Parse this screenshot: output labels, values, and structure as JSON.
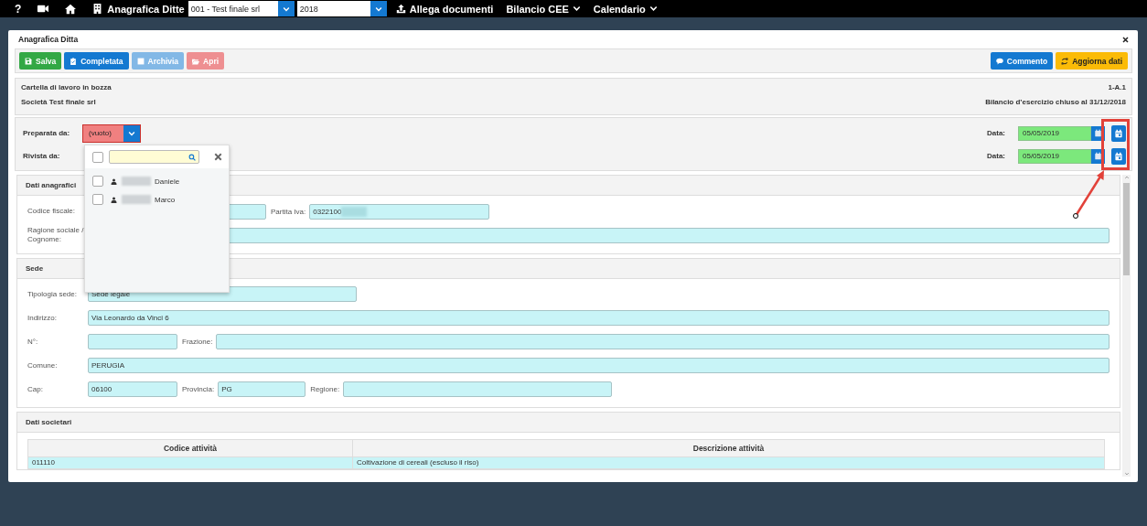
{
  "topbar": {
    "help": "?",
    "title": "Anagrafica Ditte",
    "company": "001 - Test finale srl",
    "year": "2018",
    "menu": [
      {
        "label": "Allega documenti",
        "kind": "upload"
      },
      {
        "label": "Bilancio CEE",
        "kind": "dropdown"
      },
      {
        "label": "Calendario",
        "kind": "dropdown"
      }
    ]
  },
  "window": {
    "title": "Anagrafica Ditta"
  },
  "toolbar": {
    "buttons": [
      {
        "label": "Salva",
        "kind": "save",
        "disabled": false
      },
      {
        "label": "Completata",
        "kind": "complete",
        "disabled": false
      },
      {
        "label": "Archivia",
        "kind": "archive",
        "disabled": true
      },
      {
        "label": "Apri",
        "kind": "open",
        "disabled": true
      }
    ],
    "actions": [
      {
        "label": "Commento",
        "kind": "comment"
      },
      {
        "label": "Aggiorna dati",
        "kind": "refresh"
      }
    ]
  },
  "info": {
    "status": "Cartella di lavoro in bozza",
    "company": "Società Test finale srl",
    "code": "1-A.1",
    "period": "Bilancio d’esercizio chiuso al 31/12/2018"
  },
  "signoff": [
    {
      "label": "Preparata da:",
      "value": "(vuoto)",
      "invalid": true,
      "date_label": "Data:",
      "date": "05/05/2019"
    },
    {
      "label": "Rivista da:",
      "date_label": "Data:",
      "date": "05/05/2019"
    }
  ],
  "user_dropdown": {
    "select_all": false,
    "options": [
      {
        "name": "Daniele",
        "checked": false,
        "redacted": true
      },
      {
        "name": "Marco",
        "checked": false,
        "redacted": true
      }
    ]
  },
  "sections": [
    {
      "title": "Dati anagrafici",
      "rows": [
        [
          {
            "label": "Codice fiscale:"
          },
          {
            "label": "Partita Iva:",
            "value": "0322100",
            "redacted": true
          }
        ],
        [
          {
            "label": "Ragione sociale / Cognome:"
          }
        ]
      ]
    },
    {
      "title": "Sede",
      "rows": [
        [
          {
            "label": "Tipologia sede:",
            "value": "Sede legale"
          }
        ],
        [
          {
            "label": "Indirizzo:",
            "value": "Via Leonardo da Vinci 6"
          }
        ],
        [
          {
            "label": "N°:"
          },
          {
            "label": "Frazione:"
          }
        ],
        [
          {
            "label": "Comune:",
            "value": "PERUGIA"
          }
        ],
        [
          {
            "label": "Cap:",
            "value": "06100"
          },
          {
            "label": "Provincia:",
            "value": "PG"
          },
          {
            "label": "Regione:"
          }
        ]
      ]
    },
    {
      "title": "Dati societari",
      "table": {
        "columns": [
          "Codice attività",
          "Descrizione attività"
        ],
        "rows": [
          [
            "011110",
            "Coltivazione di cereali (escluso il riso)"
          ]
        ]
      }
    }
  ]
}
